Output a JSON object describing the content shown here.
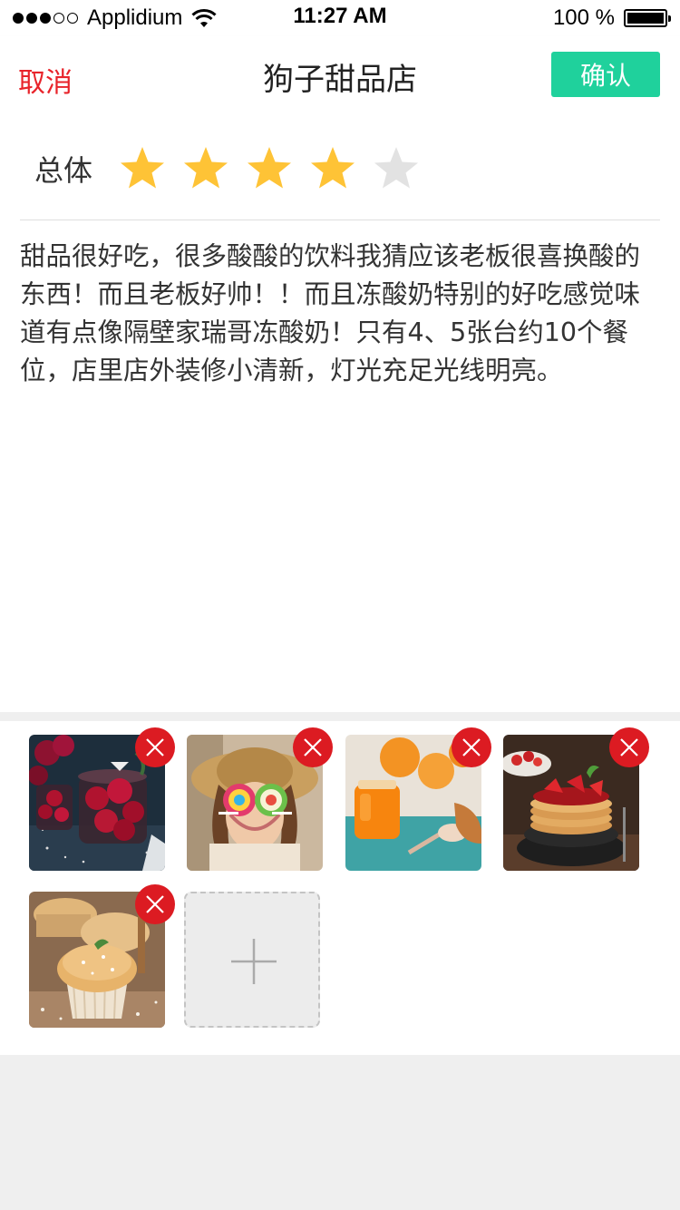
{
  "status_bar": {
    "carrier": "Applidium",
    "time": "11:27 AM",
    "battery_text": "100 %",
    "battery_level": 1.0,
    "signal_dots_filled": 3,
    "signal_dots_total": 5
  },
  "nav": {
    "cancel_label": "取消",
    "title": "狗子甜品店",
    "confirm_label": "确认"
  },
  "rating": {
    "label": "总体",
    "value": 4,
    "max": 5
  },
  "review": {
    "text": "甜品很好吃，很多酸酸的饮料我猜应该老板很喜换酸的东西！而且老板好帅！！而且冻酸奶特别的好吃感觉味道有点像隔壁家瑞哥冻酸奶！只有4、5张台约10个餐位，店里店外装修小清新，灯光充足光线明亮。"
  },
  "photos": [
    {
      "subject": "raspberries-in-jar"
    },
    {
      "subject": "girl-with-lollipops"
    },
    {
      "subject": "orange-jam"
    },
    {
      "subject": "strawberry-pancakes"
    },
    {
      "subject": "muffin"
    }
  ],
  "colors": {
    "accent_red": "#e8232a",
    "confirm_green": "#1fd19c",
    "star_on": "#fec336",
    "star_off": "#e2e2e2",
    "delete_red": "#dc1b22"
  },
  "icons": {
    "delete": "close-icon",
    "add": "plus-icon",
    "star": "star-icon"
  }
}
